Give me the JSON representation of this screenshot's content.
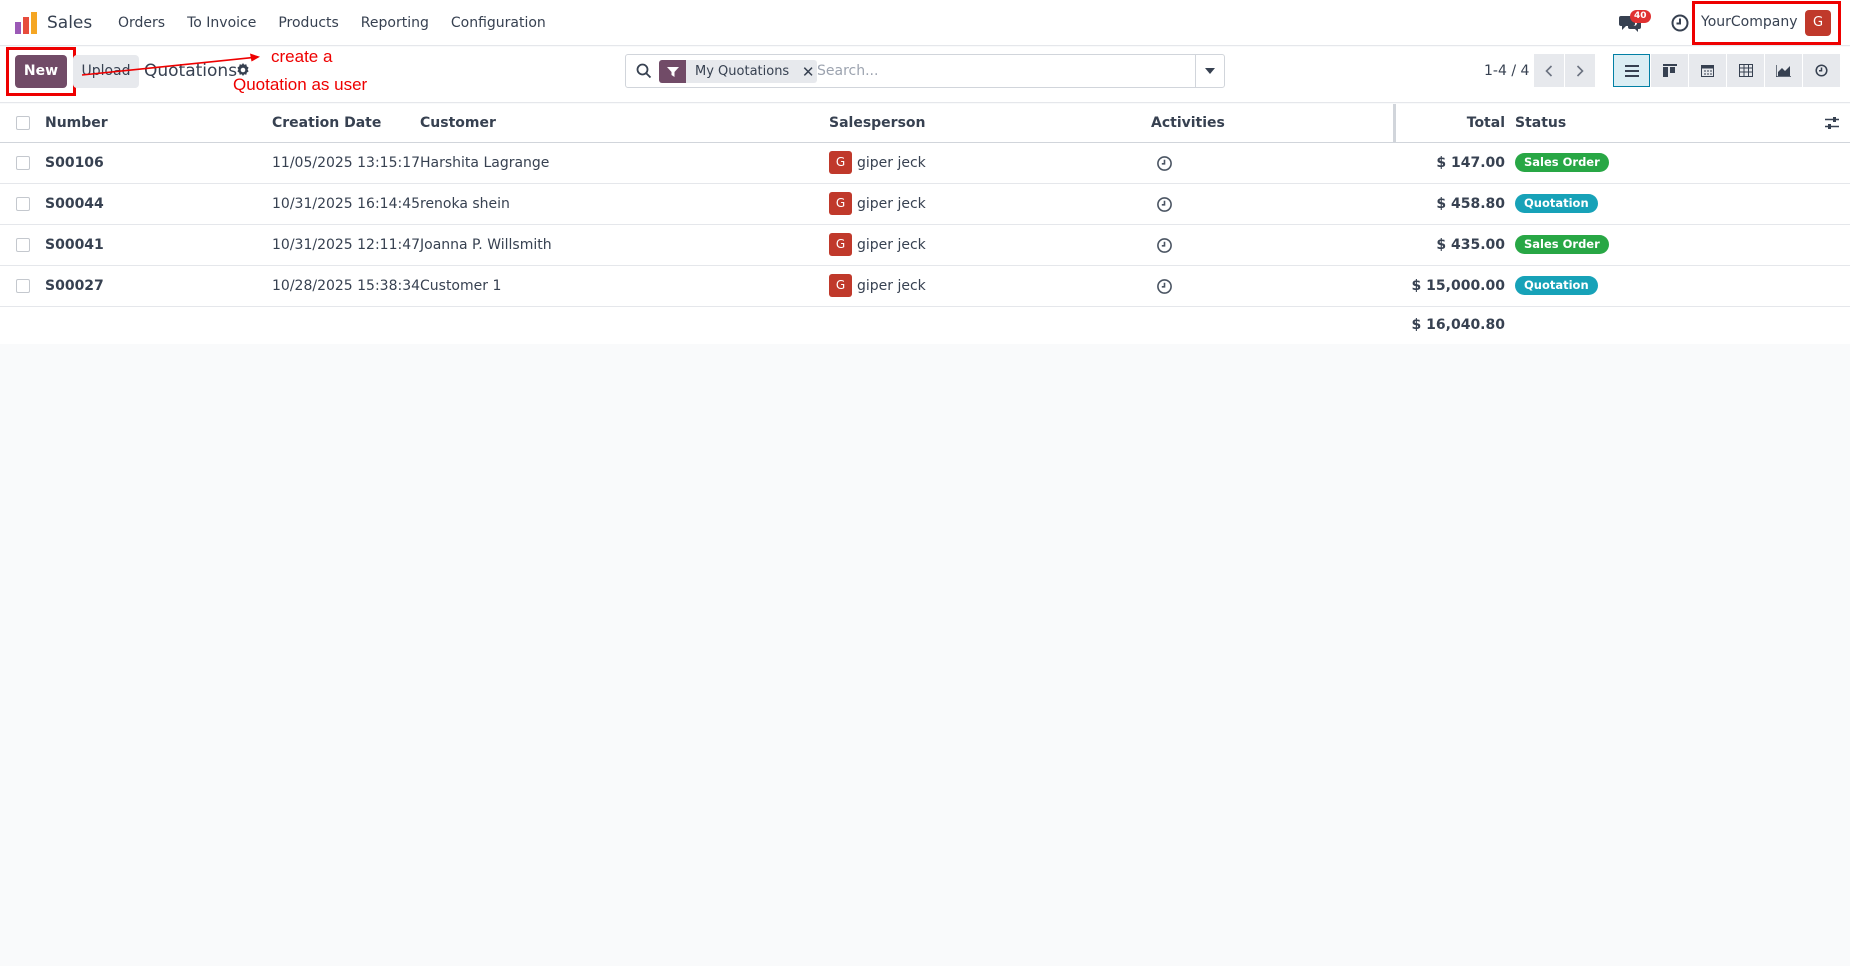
{
  "navbar": {
    "app_name": "Sales",
    "menu": [
      "Orders",
      "To Invoice",
      "Products",
      "Reporting",
      "Configuration"
    ],
    "chat_count": "40",
    "company": "YourCompany",
    "user_initial": "G"
  },
  "control": {
    "new_label": "New",
    "upload_label": "Upload",
    "breadcrumb": "Quotations",
    "search": {
      "facet": "My Quotations",
      "placeholder": "Search..."
    },
    "pager": "1-4 / 4"
  },
  "annotation": {
    "line1": "create a",
    "line2": "Quotation as user"
  },
  "table": {
    "headers": {
      "number": "Number",
      "creation_date": "Creation Date",
      "customer": "Customer",
      "salesperson": "Salesperson",
      "activities": "Activities",
      "total": "Total",
      "status": "Status"
    },
    "rows": [
      {
        "number": "S00106",
        "date": "11/05/2025 13:15:17",
        "customer": "Harshita Lagrange",
        "sp_initial": "G",
        "salesperson": "giper jeck",
        "total": "$ 147.00",
        "status": "Sales Order"
      },
      {
        "number": "S00044",
        "date": "10/31/2025 16:14:45",
        "customer": "renoka shein",
        "sp_initial": "G",
        "salesperson": "giper jeck",
        "total": "$ 458.80",
        "status": "Quotation"
      },
      {
        "number": "S00041",
        "date": "10/31/2025 12:11:47",
        "customer": "Joanna P. Willsmith",
        "sp_initial": "G",
        "salesperson": "giper jeck",
        "total": "$ 435.00",
        "status": "Sales Order"
      },
      {
        "number": "S00027",
        "date": "10/28/2025 15:38:34",
        "customer": "Customer 1",
        "sp_initial": "G",
        "salesperson": "giper jeck",
        "total": "$ 15,000.00",
        "status": "Quotation"
      }
    ],
    "sum_total": "$ 16,040.80"
  },
  "colors": {
    "brand": "#714b67",
    "sales_order": "#28a745",
    "quotation": "#17a2b8",
    "annotation": "#ee0000"
  }
}
